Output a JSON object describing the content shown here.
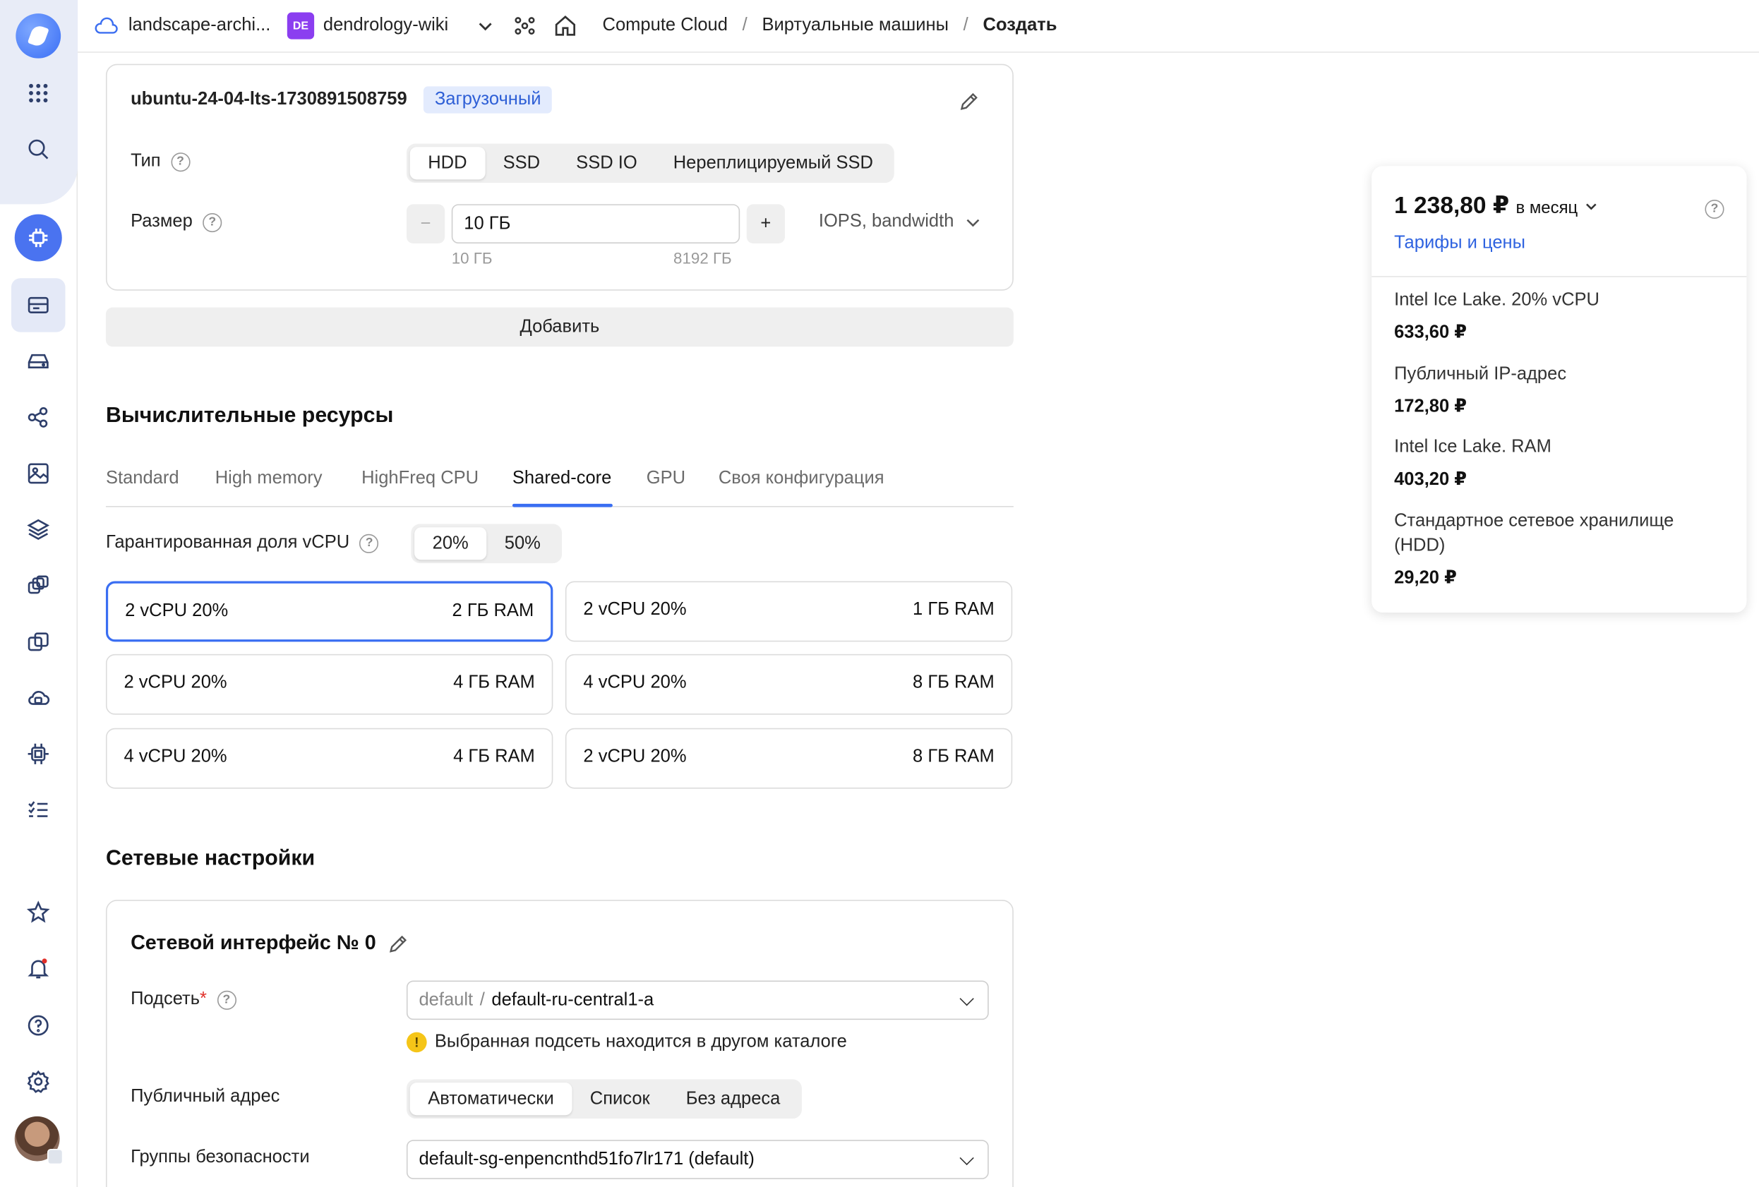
{
  "topbar": {
    "cloud_name": "landscape-archi...",
    "folder_badge": "DE",
    "folder_name": "dendrology-wiki",
    "breadcrumbs": [
      "Compute Cloud",
      "Виртуальные машины",
      "Создать"
    ],
    "separator": "/"
  },
  "disk": {
    "image_name": "ubuntu-24-04-lts-1730891508759",
    "boot_tag": "Загрузочный",
    "type_label": "Тип",
    "type_options": [
      "HDD",
      "SSD",
      "SSD IO",
      "Нереплицируемый SSD"
    ],
    "type_selected": "HDD",
    "size_label": "Размер",
    "size_value": "10 ГБ",
    "size_min": "10 ГБ",
    "size_max": "8192 ГБ",
    "minus": "−",
    "plus": "+",
    "iops_label": "IOPS, bandwidth",
    "add_button": "Добавить",
    "help_glyph": "?"
  },
  "compute": {
    "heading": "Вычислительные ресурсы",
    "tabs": [
      "Standard",
      "High memory",
      "HighFreq CPU",
      "Shared-core",
      "GPU",
      "Своя конфигурация"
    ],
    "active_tab": "Shared-core",
    "vcpu_share_label": "Гарантированная доля vCPU",
    "vcpu_share_options": [
      "20%",
      "50%"
    ],
    "vcpu_share_selected": "20%",
    "presets": [
      {
        "cpu": "2 vCPU 20%",
        "ram": "2 ГБ RAM",
        "selected": true
      },
      {
        "cpu": "2 vCPU 20%",
        "ram": "1 ГБ RAM",
        "selected": false
      },
      {
        "cpu": "2 vCPU 20%",
        "ram": "4 ГБ RAM",
        "selected": false
      },
      {
        "cpu": "4 vCPU 20%",
        "ram": "8 ГБ RAM",
        "selected": false
      },
      {
        "cpu": "4 vCPU 20%",
        "ram": "4 ГБ RAM",
        "selected": false
      },
      {
        "cpu": "2 vCPU 20%",
        "ram": "8 ГБ RAM",
        "selected": false
      }
    ]
  },
  "network": {
    "heading": "Сетевые настройки",
    "interface_title": "Сетевой интерфейс № 0",
    "subnet_label": "Подсеть",
    "required_mark": "*",
    "subnet_folder": "default",
    "subnet_sep": "/",
    "subnet_value": "default-ru-central1-a",
    "warning_text": "Выбранная подсеть находится в другом каталоге",
    "warning_glyph": "!",
    "public_address_label": "Публичный адрес",
    "public_address_options": [
      "Автоматически",
      "Список",
      "Без адреса"
    ],
    "public_address_selected": "Автоматически",
    "security_groups_label": "Группы безопасности",
    "security_group_value": "default-sg-enpencnthd51fo7lr171 (default)"
  },
  "pricing": {
    "total": "1 238,80 ₽",
    "period": "в месяц",
    "tariffs_link": "Тарифы и цены",
    "items": [
      {
        "name": "Intel Ice Lake. 20% vCPU",
        "price": "633,60 ₽"
      },
      {
        "name": "Публичный IP-адрес",
        "price": "172,80 ₽"
      },
      {
        "name": "Intel Ice Lake. RAM",
        "price": "403,20 ₽"
      },
      {
        "name": "Стандартное сетевое хранилище (HDD)",
        "price": "29,20 ₽"
      }
    ]
  },
  "colors": {
    "accent": "#3a6ef2",
    "folder_badge": "#8b3ef0",
    "warning": "#f5c518",
    "required": "#e0302a"
  }
}
